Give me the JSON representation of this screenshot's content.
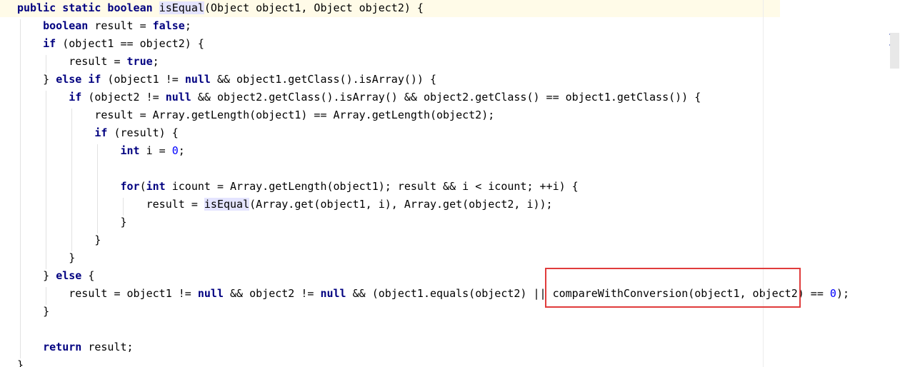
{
  "editor": {
    "lines": [
      [
        {
          "t": "public static boolean",
          "c": "kw"
        },
        {
          "t": " "
        },
        {
          "t": "isEqual",
          "c": "usage",
          "caret": true
        },
        {
          "t": "(Object object1, Object object2) {"
        }
      ],
      [
        {
          "t": "    "
        },
        {
          "t": "boolean",
          "c": "kw"
        },
        {
          "t": " result = "
        },
        {
          "t": "false",
          "c": "kw"
        },
        {
          "t": ";"
        }
      ],
      [
        {
          "t": "    "
        },
        {
          "t": "if",
          "c": "kw"
        },
        {
          "t": " (object1 == object2) {"
        }
      ],
      [
        {
          "t": "        result = "
        },
        {
          "t": "true",
          "c": "kw"
        },
        {
          "t": ";"
        }
      ],
      [
        {
          "t": "    } "
        },
        {
          "t": "else if",
          "c": "kw"
        },
        {
          "t": " (object1 != "
        },
        {
          "t": "null",
          "c": "kw"
        },
        {
          "t": " && object1.getClass().isArray()) {"
        }
      ],
      [
        {
          "t": "        "
        },
        {
          "t": "if",
          "c": "kw"
        },
        {
          "t": " (object2 != "
        },
        {
          "t": "null",
          "c": "kw"
        },
        {
          "t": " && object2.getClass().isArray() && object2.getClass() == object1.getClass()) {"
        }
      ],
      [
        {
          "t": "            result = Array.getLength(object1) == Array.getLength(object2);"
        }
      ],
      [
        {
          "t": "            "
        },
        {
          "t": "if",
          "c": "kw"
        },
        {
          "t": " (result) {"
        }
      ],
      [
        {
          "t": "                "
        },
        {
          "t": "int",
          "c": "kw"
        },
        {
          "t": " i = "
        },
        {
          "t": "0",
          "c": "num"
        },
        {
          "t": ";"
        }
      ],
      [],
      [
        {
          "t": "                "
        },
        {
          "t": "for",
          "c": "kw"
        },
        {
          "t": "("
        },
        {
          "t": "int",
          "c": "kw"
        },
        {
          "t": " icount = Array.getLength(object1); result && i < icount; ++i) {"
        }
      ],
      [
        {
          "t": "                    result = "
        },
        {
          "t": "isEqual",
          "c": "usage"
        },
        {
          "t": "(Array.get(object1, i), Array.get(object2, i));"
        }
      ],
      [
        {
          "t": "                }"
        }
      ],
      [
        {
          "t": "            }"
        }
      ],
      [
        {
          "t": "        }"
        }
      ],
      [
        {
          "t": "    } "
        },
        {
          "t": "else",
          "c": "kw"
        },
        {
          "t": " {"
        }
      ],
      [
        {
          "t": "        result = object1 != "
        },
        {
          "t": "null",
          "c": "kw"
        },
        {
          "t": " && object2 != "
        },
        {
          "t": "null",
          "c": "kw"
        },
        {
          "t": " && (object1.equals(object2) || compareWithConversion(object1, object2) == "
        },
        {
          "t": "0",
          "c": "num"
        },
        {
          "t": ");"
        }
      ],
      [
        {
          "t": "    }"
        }
      ],
      [],
      [
        {
          "t": "    "
        },
        {
          "t": "return",
          "c": "kw"
        },
        {
          "t": " result;"
        }
      ],
      [
        {
          "t": "}"
        }
      ]
    ]
  },
  "colors": {
    "keyword": "#000080",
    "number": "#0000ff",
    "usage_highlight": "#e4e4ff",
    "current_line": "#fffbe8",
    "annotation_box": "#e03c3c"
  }
}
